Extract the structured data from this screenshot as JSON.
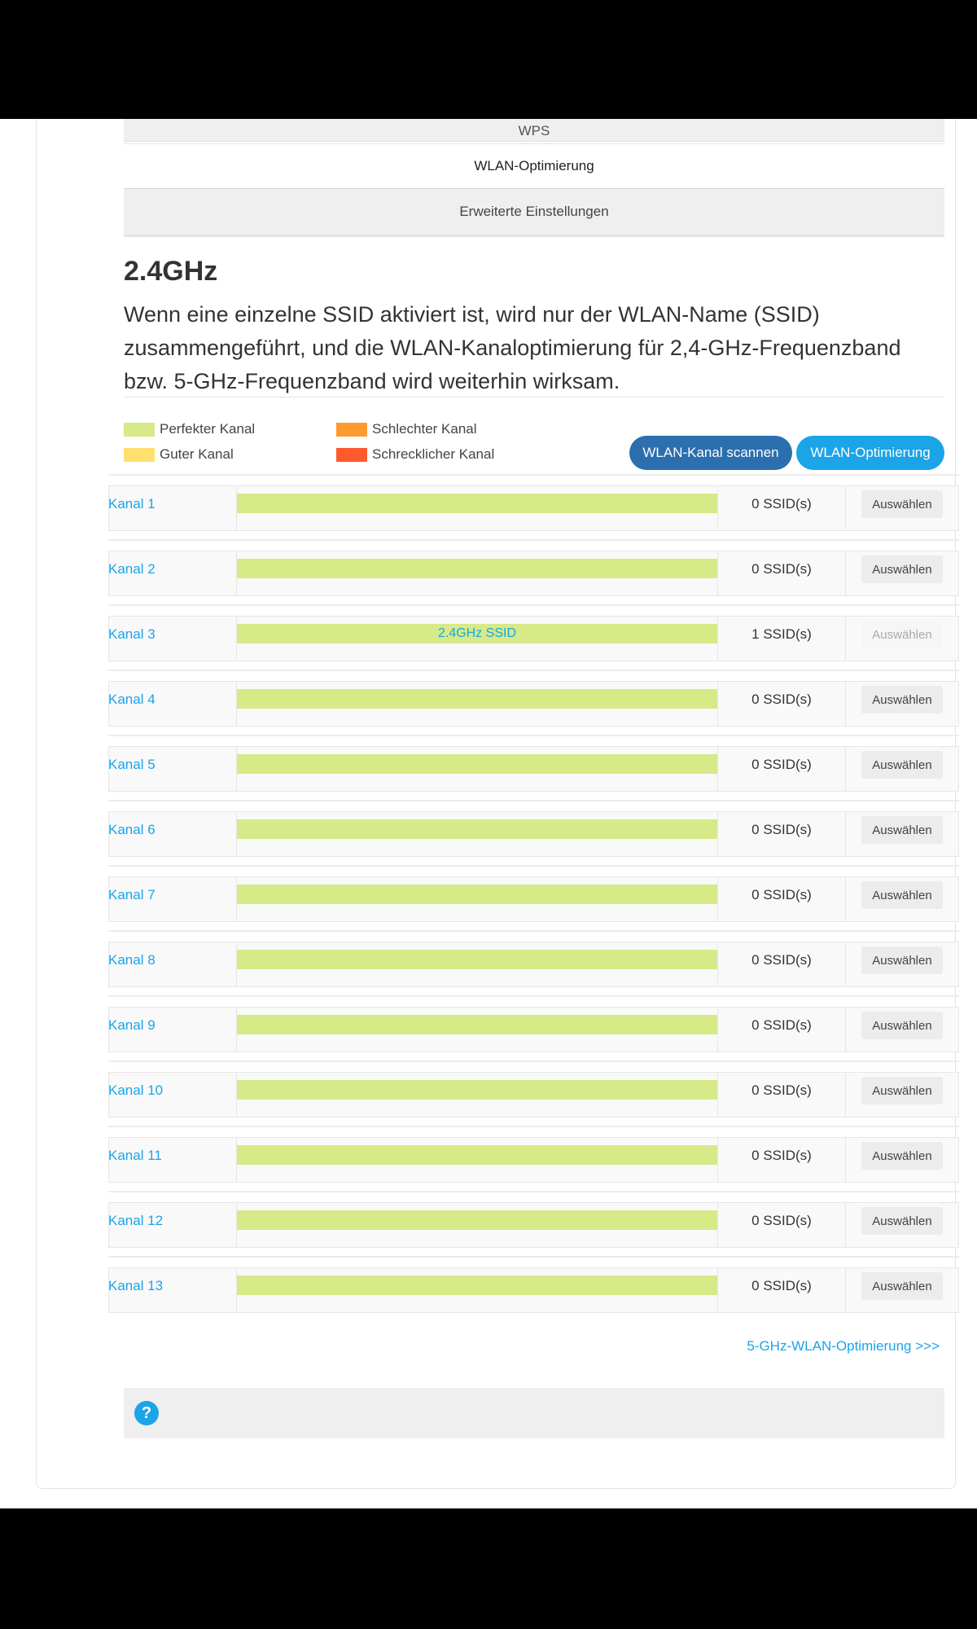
{
  "menu": {
    "items": [
      {
        "label": "WPS"
      },
      {
        "label": "WLAN-Optimierung"
      },
      {
        "label": "Erweiterte Einstellungen"
      }
    ]
  },
  "band": {
    "title": "2.4GHz",
    "description": "Wenn eine einzelne SSID aktiviert ist, wird nur der WLAN-Name (SSID) zusammengeführt, und die WLAN-Kanaloptimierung für 2,4-GHz-Frequenzband bzw. 5-GHz-Frequenzband wird weiterhin wirksam."
  },
  "legend": {
    "items": [
      {
        "label": "Perfekter Kanal",
        "color": "#d6ea87"
      },
      {
        "label": "Guter Kanal",
        "color": "#ffdf6e"
      },
      {
        "label": "Schlechter Kanal",
        "color": "#ff9a2e"
      },
      {
        "label": "Schrecklicher Kanal",
        "color": "#ff5a2e"
      }
    ]
  },
  "actions": {
    "scan_label": "WLAN-Kanal scannen",
    "optimize_label": "WLAN-Optimierung"
  },
  "channels": [
    {
      "label": "Kanal  1",
      "bar_text": "",
      "ssid_count": "0 SSID(s)",
      "select_label": "Auswählen",
      "disabled": false
    },
    {
      "label": "Kanal  2",
      "bar_text": "",
      "ssid_count": "0 SSID(s)",
      "select_label": "Auswählen",
      "disabled": false
    },
    {
      "label": "Kanal  3",
      "bar_text": "2.4GHz SSID",
      "ssid_count": "1 SSID(s)",
      "select_label": "Auswählen",
      "disabled": true
    },
    {
      "label": "Kanal  4",
      "bar_text": "",
      "ssid_count": "0 SSID(s)",
      "select_label": "Auswählen",
      "disabled": false
    },
    {
      "label": "Kanal  5",
      "bar_text": "",
      "ssid_count": "0 SSID(s)",
      "select_label": "Auswählen",
      "disabled": false
    },
    {
      "label": "Kanal  6",
      "bar_text": "",
      "ssid_count": "0 SSID(s)",
      "select_label": "Auswählen",
      "disabled": false
    },
    {
      "label": "Kanal  7",
      "bar_text": "",
      "ssid_count": "0 SSID(s)",
      "select_label": "Auswählen",
      "disabled": false
    },
    {
      "label": "Kanal  8",
      "bar_text": "",
      "ssid_count": "0 SSID(s)",
      "select_label": "Auswählen",
      "disabled": false
    },
    {
      "label": "Kanal  9",
      "bar_text": "",
      "ssid_count": "0 SSID(s)",
      "select_label": "Auswählen",
      "disabled": false
    },
    {
      "label": "Kanal  10",
      "bar_text": "",
      "ssid_count": "0 SSID(s)",
      "select_label": "Auswählen",
      "disabled": false
    },
    {
      "label": "Kanal  11",
      "bar_text": "",
      "ssid_count": "0 SSID(s)",
      "select_label": "Auswählen",
      "disabled": false
    },
    {
      "label": "Kanal  12",
      "bar_text": "",
      "ssid_count": "0 SSID(s)",
      "select_label": "Auswählen",
      "disabled": false
    },
    {
      "label": "Kanal  13",
      "bar_text": "",
      "ssid_count": "0 SSID(s)",
      "select_label": "Auswählen",
      "disabled": false
    }
  ],
  "footer": {
    "link_5ghz": "5-GHz-WLAN-Optimierung >>>",
    "help_icon": "question-icon",
    "help_glyph": "?"
  }
}
